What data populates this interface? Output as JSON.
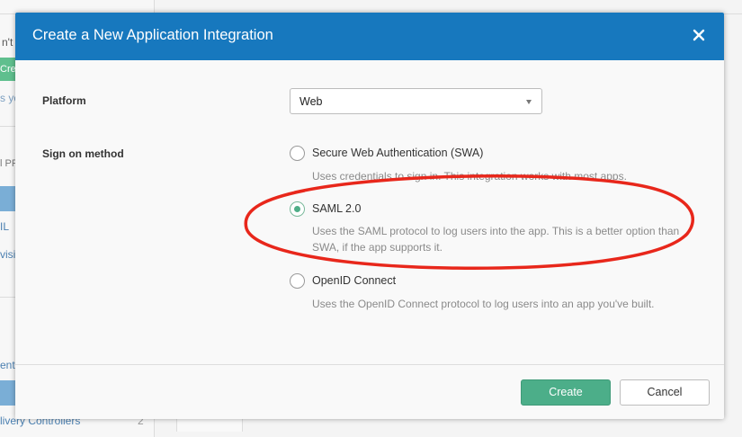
{
  "background": {
    "fragments": [
      "n't",
      "Crea",
      "s yo",
      "l PR",
      "IL",
      "visi",
      "ent",
      "livery Controllers",
      "2"
    ]
  },
  "dialog": {
    "title": "Create a New Application Integration",
    "platform": {
      "label": "Platform",
      "selected": "Web"
    },
    "sign_on": {
      "label": "Sign on method",
      "options": [
        {
          "title": "Secure Web Authentication (SWA)",
          "description": "Uses credentials to sign in. This integration works with most apps.",
          "checked": false
        },
        {
          "title": "SAML 2.0",
          "description": "Uses the SAML protocol to log users into the app. This is a better option than SWA, if the app supports it.",
          "checked": true
        },
        {
          "title": "OpenID Connect",
          "description": "Uses the OpenID Connect protocol to log users into an app you've built.",
          "checked": false
        }
      ]
    },
    "buttons": {
      "create": "Create",
      "cancel": "Cancel"
    }
  },
  "colors": {
    "header": "#1778be",
    "primary_button": "#4cae89",
    "annotation": "#e8271b"
  },
  "icons": {
    "close": "close-icon",
    "dropdown": "chevron-down-icon"
  }
}
